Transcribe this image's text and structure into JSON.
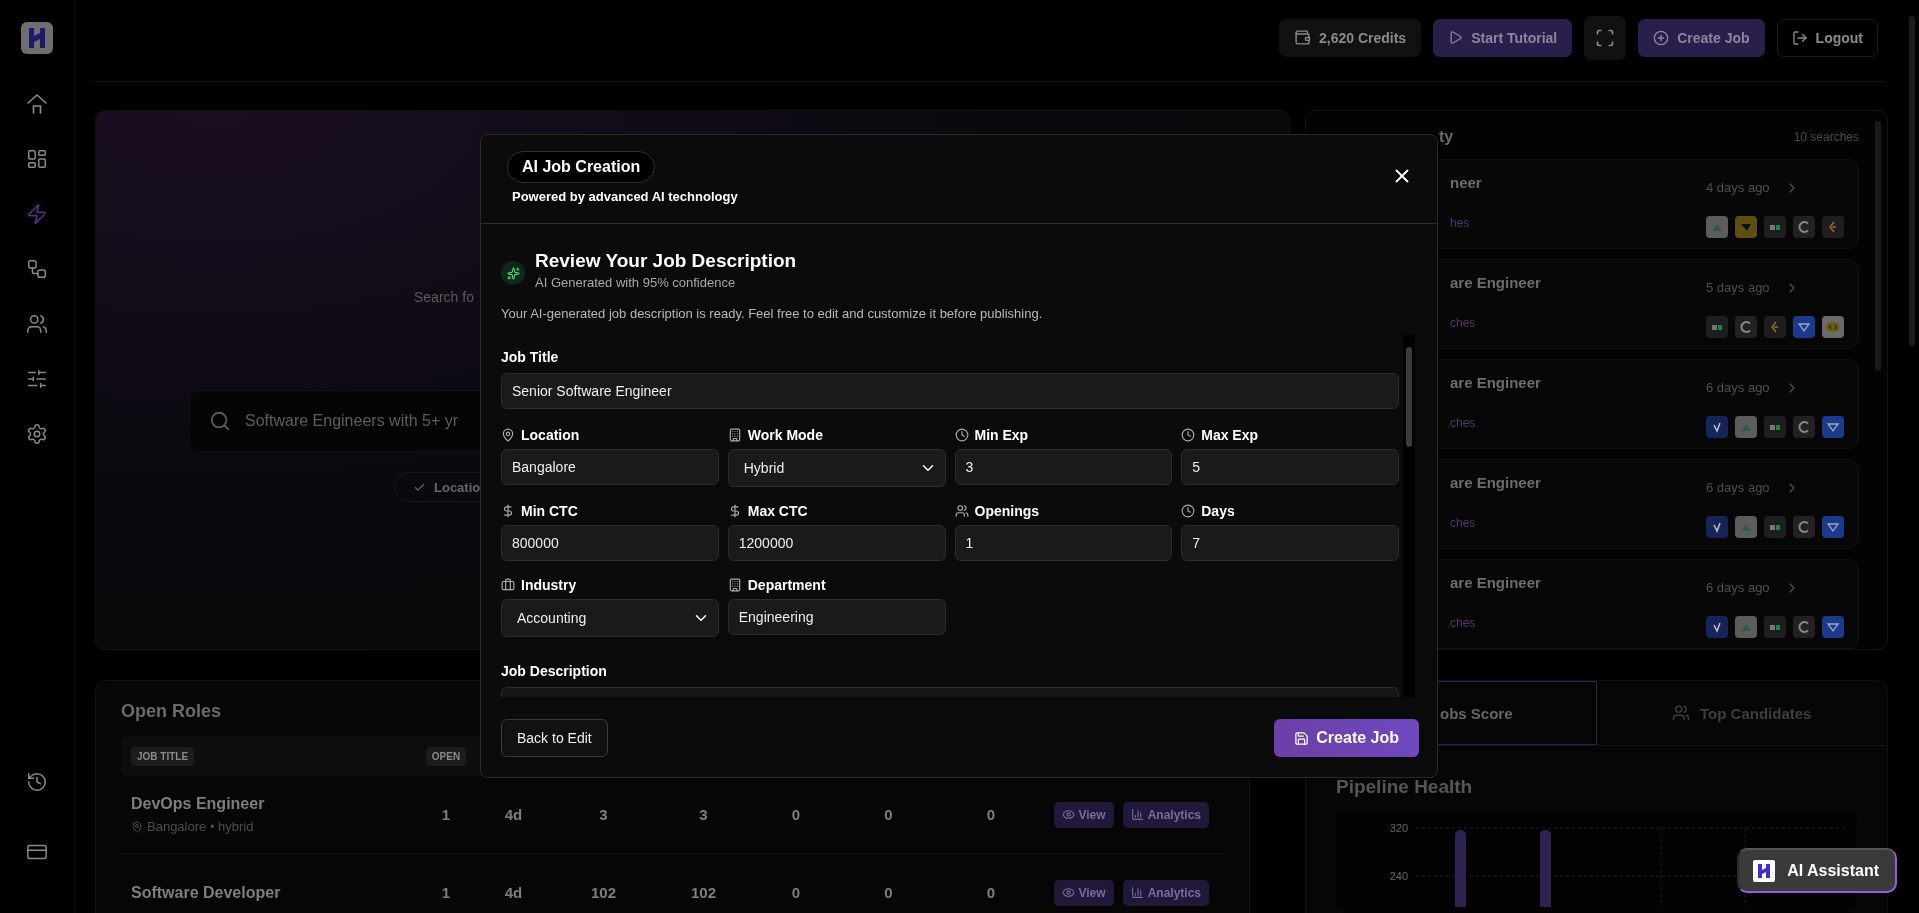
{
  "top_bar": {
    "credits": "2,620 Credits",
    "buttons": [
      {
        "label": "Start Tutorial",
        "kind": "tutorial"
      },
      {
        "kind": "fullscreen"
      },
      {
        "label": "Create Job",
        "kind": "create"
      },
      {
        "label": "Logout",
        "kind": "logout"
      }
    ]
  },
  "sidebar": {
    "items": [
      {
        "kind": "home",
        "selected": false
      },
      {
        "kind": "dashboard",
        "selected": false
      },
      {
        "kind": "bolt",
        "selected": true
      },
      {
        "kind": "workflow",
        "selected": false
      },
      {
        "kind": "users",
        "selected": false
      },
      {
        "kind": "sliders",
        "selected": false
      },
      {
        "kind": "settings",
        "selected": false
      }
    ],
    "bottom_items": [
      {
        "kind": "history"
      },
      {
        "kind": "card"
      }
    ]
  },
  "hero": {
    "subtitle": "Search fo",
    "search": {
      "placeholder": "Software Engineers with 5+ yr"
    },
    "chips": [
      {
        "label": "Locatio",
        "checked": true
      }
    ]
  },
  "recent_activity": {
    "title": "ty",
    "count": "10 searches",
    "items": [
      {
        "title": "neer",
        "matches": "hes",
        "time": "4 days ago"
      },
      {
        "title": "are Engineer",
        "matches": "ches",
        "time": "5 days ago"
      },
      {
        "title": "are Engineer",
        "matches": "ches",
        "time": "6 days ago"
      },
      {
        "title": "are Engineer",
        "matches": "ches",
        "time": "6 days ago"
      },
      {
        "title": "are Engineer",
        "matches": "ches",
        "time": "6 days ago"
      }
    ]
  },
  "open_roles": {
    "title": "Open Roles",
    "columns": [
      "JOB TITLE",
      "OPEN"
    ],
    "rows": [
      {
        "cells": [
          "DevOps Engineer",
          "1",
          "4d",
          "3",
          "3",
          "0",
          "0",
          "0"
        ],
        "meta": "Bangalore • hybrid",
        "actions": [
          {
            "label": "View",
            "kind": "view"
          },
          {
            "label": "Analytics",
            "kind": "analytics"
          }
        ]
      },
      {
        "cells": [
          "Software Developer",
          "1",
          "4d",
          "102",
          "102",
          "0",
          "0",
          "0"
        ],
        "actions": [
          {
            "label": "View",
            "kind": "view"
          },
          {
            "label": "Analytics",
            "kind": "analytics"
          }
        ]
      }
    ]
  },
  "insights": {
    "tabs": [
      {
        "label": "obs Score",
        "selected": true,
        "kind": "score"
      },
      {
        "label": "Top Candidates",
        "selected": false,
        "kind": "candidates"
      }
    ],
    "title": "Pipeline Health",
    "y_ticks": [
      "320",
      "240"
    ]
  },
  "assistant": {
    "label": "AI Assistant"
  },
  "modal": {
    "badge": "AI Job Creation",
    "subtitle": "Powered by advanced AI technology",
    "section": {
      "title": "Review Your Job Description",
      "confidence": "AI Generated with 95% confidence",
      "intro": "Your AI-generated job description is ready. Feel free to edit and customize it before publishing."
    },
    "job_title": {
      "label": "Job Title",
      "value": "Senior Software Engineer"
    },
    "fields": [
      {
        "label": "Location",
        "kind": "text",
        "value": "Bangalore"
      },
      {
        "label": "Work Mode",
        "kind": "select",
        "value": "Hybrid"
      },
      {
        "label": "Min Exp",
        "kind": "text",
        "value": "3"
      },
      {
        "label": "Max Exp",
        "kind": "text",
        "value": "5"
      },
      {
        "label": "Min CTC",
        "kind": "text",
        "value": "800000"
      },
      {
        "label": "Max CTC",
        "kind": "text",
        "value": "1200000"
      },
      {
        "label": "Openings",
        "kind": "text",
        "value": "1"
      },
      {
        "label": "Days",
        "kind": "text",
        "value": "7"
      },
      {
        "label": "Industry",
        "kind": "select",
        "value": "Accounting"
      },
      {
        "label": "Department",
        "kind": "text",
        "value": "Engineering"
      }
    ],
    "description_label": "Job Description",
    "back": "Back to Edit",
    "submit": "Create Job"
  }
}
